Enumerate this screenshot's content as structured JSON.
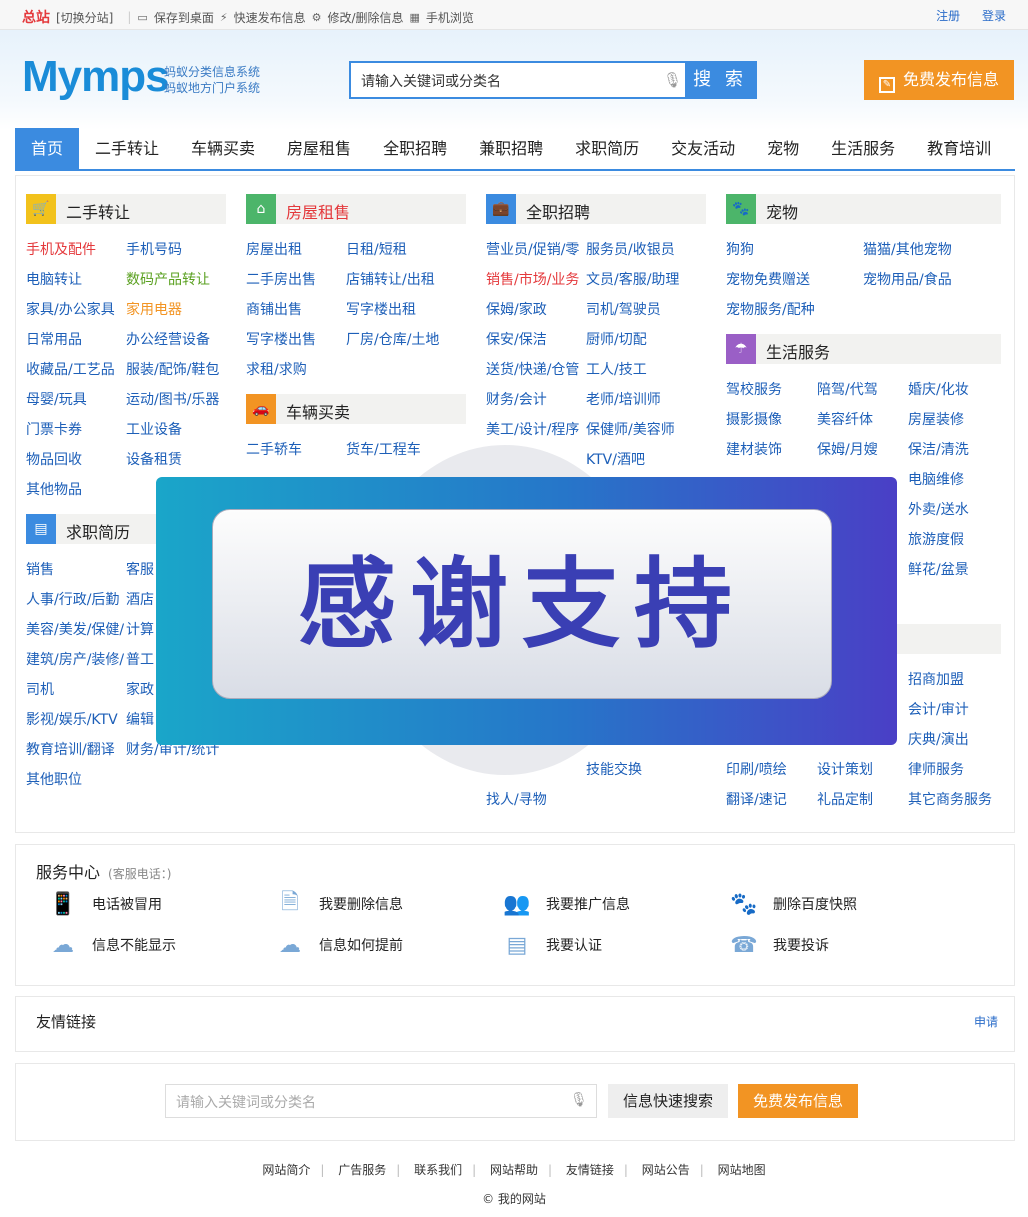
{
  "topbar": {
    "brand": "总站",
    "switch": "[切换分站]",
    "links": [
      "保存到桌面",
      "快速发布信息",
      "修改/删除信息",
      "手机浏览"
    ],
    "register": "注册",
    "login": "登录"
  },
  "header": {
    "logo": "Mymps",
    "slogan1": "蚂蚁分类信息系统",
    "slogan2": "蚂蚁地方门户系统",
    "search_placeholder": "请输入关键词或分类名",
    "search_button": "搜 索",
    "post_button": "免费发布信息"
  },
  "nav": [
    "首页",
    "二手转让",
    "车辆买卖",
    "房屋租售",
    "全职招聘",
    "兼职招聘",
    "求职简历",
    "交友活动",
    "宠物",
    "生活服务",
    "教育培训"
  ],
  "categories": {
    "ershou": {
      "title": "二手转让",
      "items": [
        "手机及配件",
        "手机号码",
        "电脑转让",
        "数码产品转让",
        "家具/办公家具",
        "家用电器",
        "日常用品",
        "办公经营设备",
        "收藏品/工艺品",
        "服装/配饰/鞋包",
        "母婴/玩具",
        "运动/图书/乐器",
        "门票卡券",
        "工业设备",
        "物品回收",
        "设备租赁",
        "其他物品"
      ]
    },
    "fangwu": {
      "title": "房屋租售",
      "items": [
        "房屋出租",
        "日租/短租",
        "二手房出售",
        "店铺转让/出租",
        "商铺出售",
        "写字楼出租",
        "写字楼出售",
        "厂房/仓库/土地",
        "求租/求购"
      ]
    },
    "cheliang": {
      "title": "车辆买卖",
      "items": [
        "二手轿车",
        "货车/工程车"
      ]
    },
    "quanzhi": {
      "title": "全职招聘",
      "items": [
        "营业员/促销/零",
        "服务员/收银员",
        "销售/市场/业务",
        "文员/客服/助理",
        "保姆/家政",
        "司机/驾驶员",
        "保安/保洁",
        "厨师/切配",
        "送货/快递/仓管",
        "工人/技工",
        "财务/会计",
        "老师/培训师",
        "美工/设计/程序",
        "保健师/美容师",
        "KTV/酒吧"
      ]
    },
    "chongwu": {
      "title": "宠物",
      "items": [
        "狗狗",
        "猫猫/其他宠物",
        "宠物免费赠送",
        "宠物用品/食品",
        "宠物服务/配种"
      ]
    },
    "shenghuo": {
      "title": "生活服务",
      "items": [
        "驾校服务",
        "陪驾/代驾",
        "婚庆/化妆",
        "摄影摄像",
        "美容纤体",
        "房屋装修",
        "建材装饰",
        "保姆/月嫂",
        "保洁/清洗",
        "电脑维修",
        "外卖/送水",
        "旅游度假",
        "鲜花/盆景"
      ]
    },
    "qiuzhi": {
      "title": "求职简历",
      "items": [
        "销售",
        "客服",
        "人事/行政/后勤",
        "酒店",
        "美容/美发/保健/",
        "计算",
        "建筑/房产/装修/",
        "普工",
        "司机",
        "家政",
        "影视/娱乐/KTV",
        "编辑",
        "教育培训/翻译",
        "财务/审计/统计",
        "其他职位"
      ]
    },
    "jiaoyou": {
      "items": [
        "找人/寻物",
        "技能交换"
      ]
    },
    "shangwu": {
      "items": [
        "招商加盟",
        "会计/审计",
        "庆典/演出",
        "印刷/喷绘",
        "设计策划",
        "律师服务",
        "翻译/速记",
        "礼品定制",
        "其它商务服务"
      ]
    }
  },
  "overlay": {
    "text": "感谢支持"
  },
  "service": {
    "title": "服务中心",
    "phone": "(客服电话：)",
    "items": [
      "电话被冒用",
      "我要删除信息",
      "我要推广信息",
      "删除百度快照",
      "信息不能显示",
      "信息如何提前",
      "我要认证",
      "我要投诉"
    ]
  },
  "friends": {
    "title": "友情链接",
    "apply": "申请"
  },
  "bottom_search": {
    "placeholder": "请输入关键词或分类名",
    "search": "信息快速搜索",
    "post": "免费发布信息"
  },
  "footer": {
    "links": [
      "网站简介",
      "广告服务",
      "联系我们",
      "网站帮助",
      "友情链接",
      "网站公告",
      "网站地图"
    ],
    "copyright": "© 我的网站"
  },
  "colors": {
    "primary": "#3b8be0",
    "accent": "#f29423",
    "link": "#1d5fb8",
    "red": "#e4393c"
  }
}
